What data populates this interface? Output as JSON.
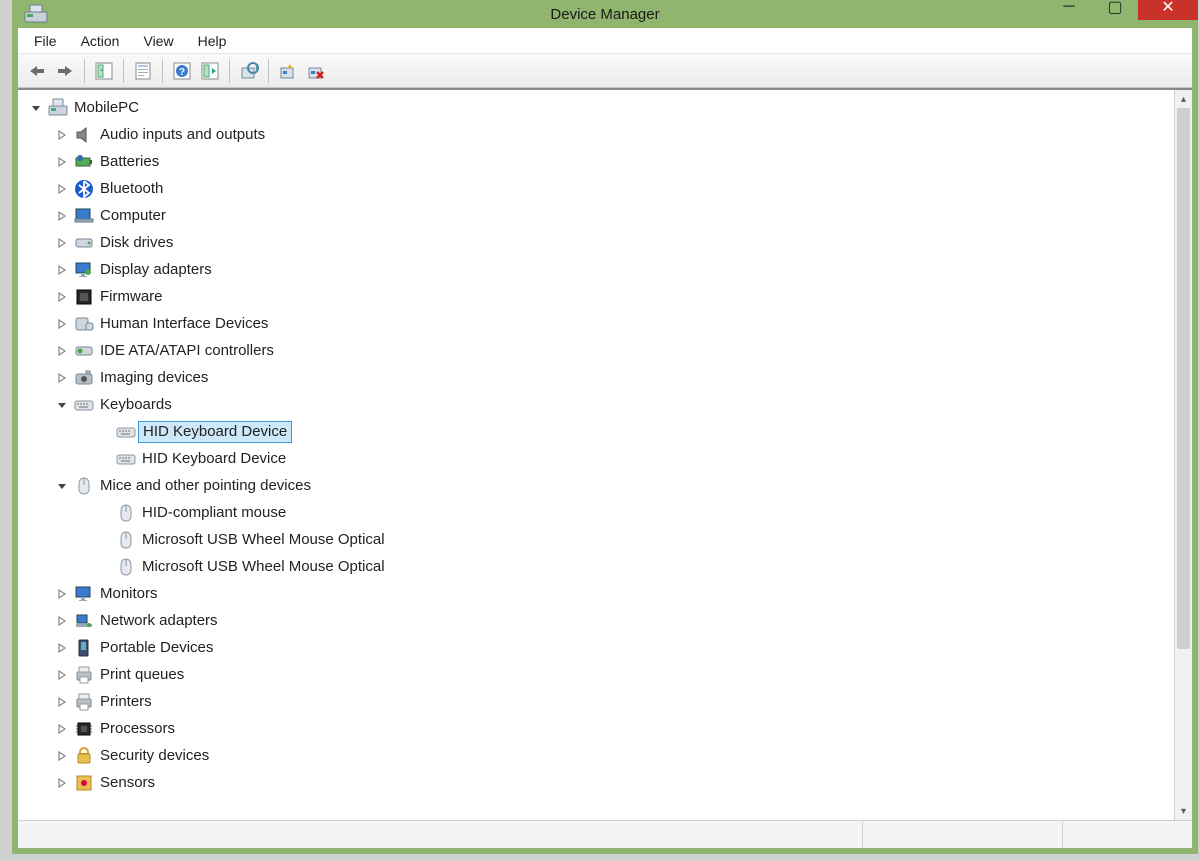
{
  "window": {
    "title": "Device Manager"
  },
  "menu": {
    "file": "File",
    "action": "Action",
    "view": "View",
    "help": "Help"
  },
  "toolbar_icons": {
    "back": "back-icon",
    "forward": "forward-icon",
    "show_hidden": "show-hidden-icon",
    "properties": "properties-icon",
    "help": "help-icon",
    "refresh": "refresh-icon",
    "update_driver": "update-driver-icon",
    "scan": "scan-hardware-icon",
    "uninstall": "uninstall-icon"
  },
  "root": {
    "label": "MobilePC",
    "expanded": true,
    "children": [
      {
        "label": "Audio inputs and outputs",
        "icon": "speaker",
        "expanded": false
      },
      {
        "label": "Batteries",
        "icon": "battery",
        "expanded": false
      },
      {
        "label": "Bluetooth",
        "icon": "bluetooth",
        "expanded": false
      },
      {
        "label": "Computer",
        "icon": "computer",
        "expanded": false
      },
      {
        "label": "Disk drives",
        "icon": "disk",
        "expanded": false
      },
      {
        "label": "Display adapters",
        "icon": "display",
        "expanded": false
      },
      {
        "label": "Firmware",
        "icon": "firmware",
        "expanded": false
      },
      {
        "label": "Human Interface Devices",
        "icon": "hid",
        "expanded": false
      },
      {
        "label": "IDE ATA/ATAPI controllers",
        "icon": "ide",
        "expanded": false
      },
      {
        "label": "Imaging devices",
        "icon": "camera",
        "expanded": false
      },
      {
        "label": "Keyboards",
        "icon": "keyboard",
        "expanded": true,
        "children": [
          {
            "label": "HID Keyboard Device",
            "icon": "keyboard",
            "selected": true
          },
          {
            "label": "HID Keyboard Device",
            "icon": "keyboard"
          }
        ]
      },
      {
        "label": "Mice and other pointing devices",
        "icon": "mouse",
        "expanded": true,
        "children": [
          {
            "label": "HID-compliant mouse",
            "icon": "mouse"
          },
          {
            "label": "Microsoft USB Wheel Mouse Optical",
            "icon": "mouse"
          },
          {
            "label": "Microsoft USB Wheel Mouse Optical",
            "icon": "mouse"
          }
        ]
      },
      {
        "label": "Monitors",
        "icon": "monitor",
        "expanded": false
      },
      {
        "label": "Network adapters",
        "icon": "network",
        "expanded": false
      },
      {
        "label": "Portable Devices",
        "icon": "portable",
        "expanded": false
      },
      {
        "label": "Print queues",
        "icon": "printer",
        "expanded": false
      },
      {
        "label": "Printers",
        "icon": "printer",
        "expanded": false
      },
      {
        "label": "Processors",
        "icon": "cpu",
        "expanded": false
      },
      {
        "label": "Security devices",
        "icon": "security",
        "expanded": false
      },
      {
        "label": "Sensors",
        "icon": "sensor",
        "expanded": false
      }
    ]
  }
}
